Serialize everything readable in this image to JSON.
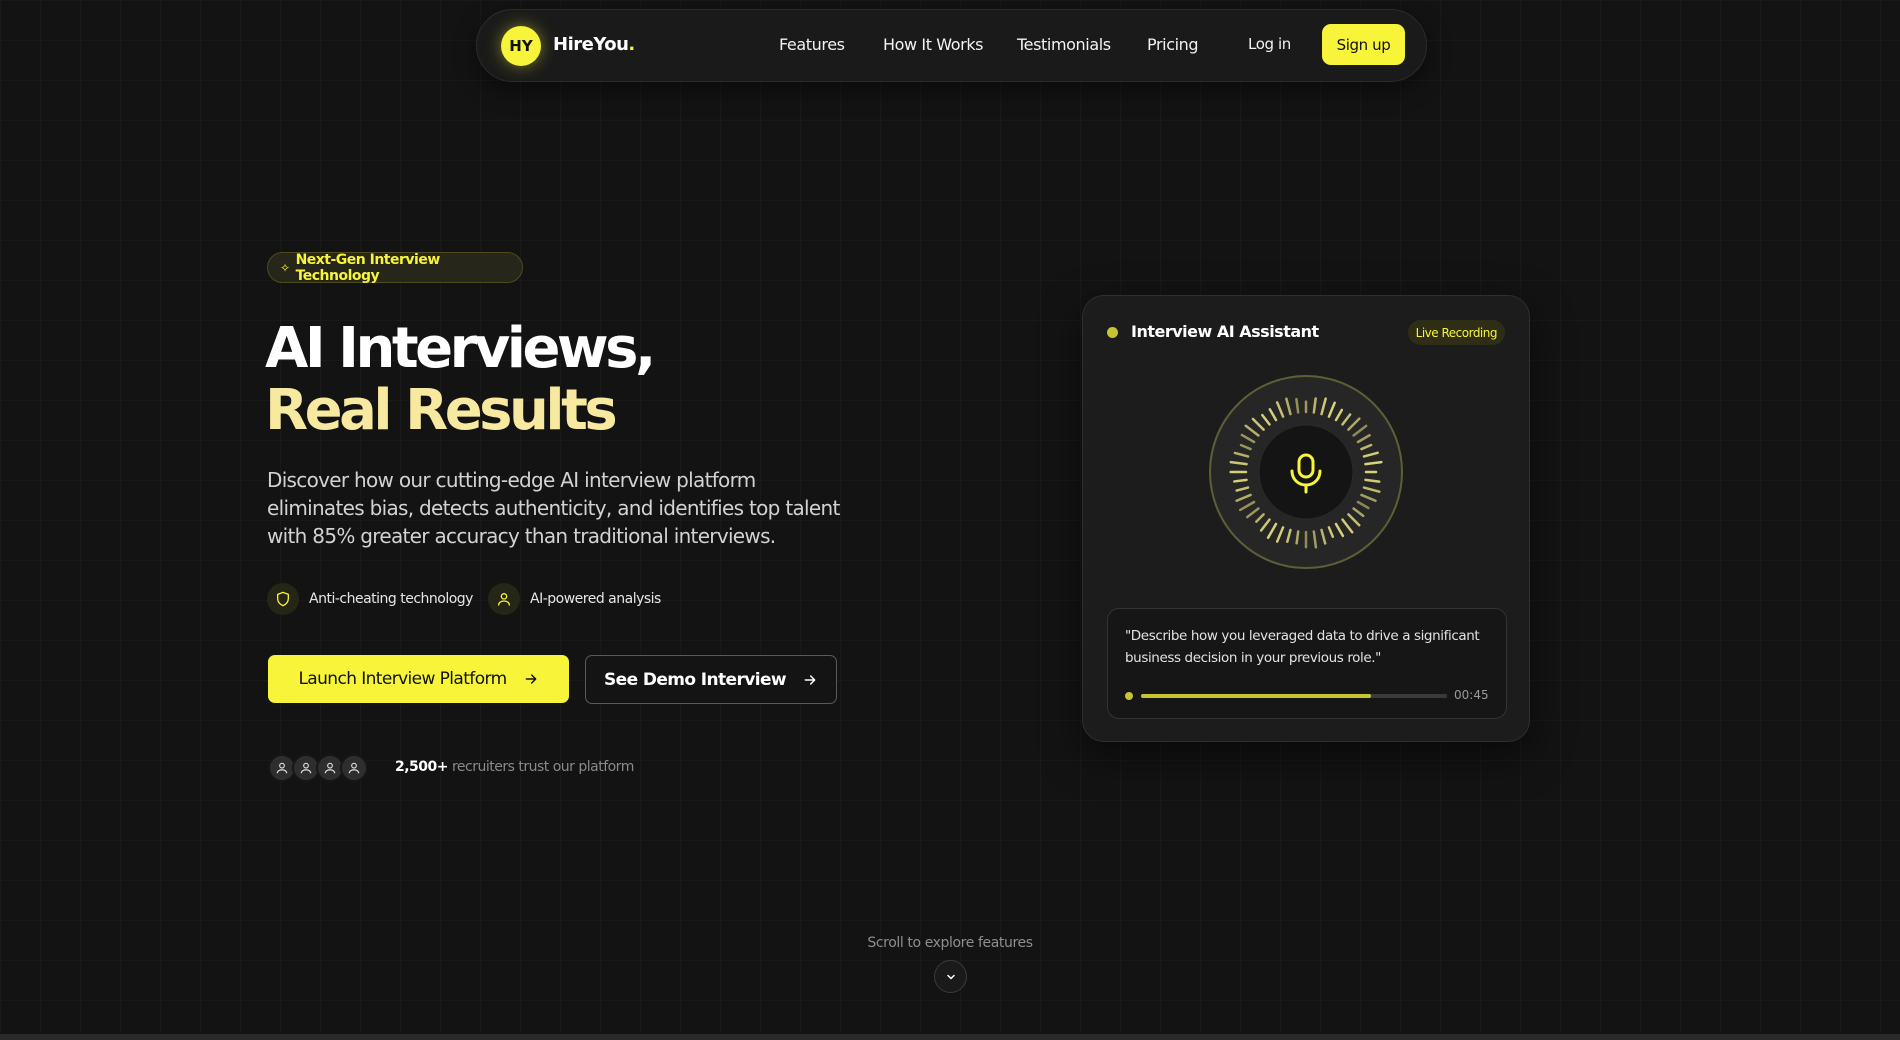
{
  "nav": {
    "logo_initials": "HY",
    "logo_name": "HireYou",
    "logo_dot": ".",
    "links": [
      "Features",
      "How It Works",
      "Testimonials",
      "Pricing"
    ],
    "login": "Log in",
    "signup": "Sign up"
  },
  "hero": {
    "badge": "Next-Gen Interview Technology",
    "title_line1": "AI Interviews,",
    "title_line2": "Real Results",
    "description": "Discover how our cutting-edge AI interview platform eliminates bias, detects authenticity, and identifies top talent with 85% greater accuracy than traditional interviews.",
    "features": [
      "Anti-cheating technology",
      "AI-powered analysis"
    ],
    "primary_button": "Launch Interview Platform",
    "secondary_button": "See Demo Interview",
    "trust_count": "2,500+",
    "trust_text": "recruiters trust our platform"
  },
  "card": {
    "title": "Interview AI Assistant",
    "badge": "Live Recording",
    "question": "\"Describe how you leveraged data to drive a significant business decision in your previous role.\"",
    "progress": 0.75,
    "time": "00:45"
  },
  "scroll": {
    "label": "Scroll to explore features"
  },
  "colors": {
    "accent": "#f7f43a",
    "accent_soft": "#f7e9a0",
    "background": "#131313"
  }
}
